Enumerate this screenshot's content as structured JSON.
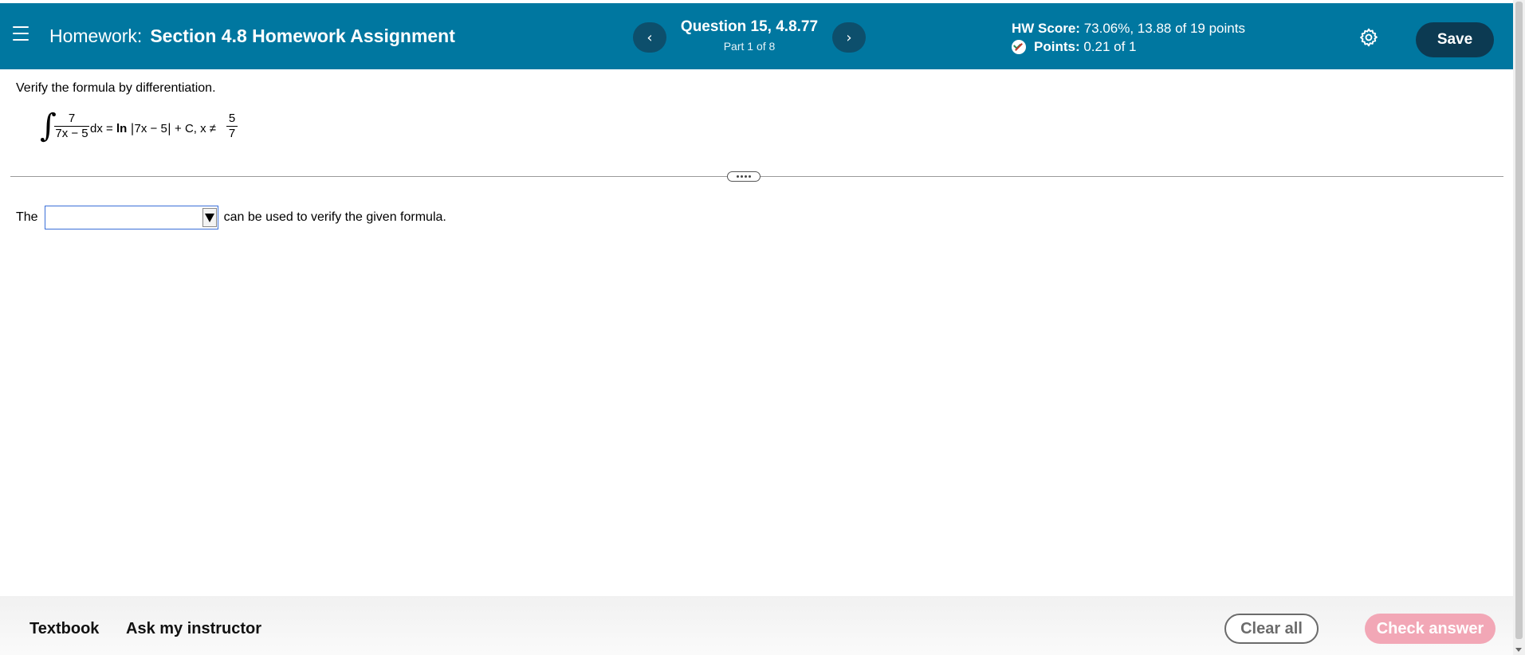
{
  "header": {
    "homework_prefix": "Homework:",
    "homework_name": "Section 4.8 Homework Assignment",
    "question_title": "Question 15, 4.8.77",
    "question_part": "Part 1 of 8",
    "prev_label": "‹",
    "next_label": "›",
    "hw_score_label": "HW Score:",
    "hw_score_value": "73.06%, 13.88 of 19 points",
    "points_label": "Points:",
    "points_value": "0.21 of 1",
    "save_label": "Save",
    "colors": {
      "background": "#0077a0",
      "nav_button": "#0d4f6c",
      "save_button": "#0c3a52"
    }
  },
  "question": {
    "prompt": "Verify the formula by differentiation.",
    "formula": {
      "integral_sign": "∫",
      "lhs_numerator": "7",
      "lhs_denominator": "7x − 5",
      "dx_eq": "dx =",
      "ln": "ln",
      "abs_open": "|",
      "abs_content": "7x − 5",
      "abs_close": "|",
      "plus_c": "+ C, x ≠",
      "rhs_numerator": "5",
      "rhs_denominator": "7"
    },
    "answer_prefix": "The",
    "answer_select_value": "",
    "answer_suffix": "can be used to verify the given formula."
  },
  "footer": {
    "textbook_label": "Textbook",
    "ask_instructor_label": "Ask my instructor",
    "clear_all_label": "Clear all",
    "check_answer_label": "Check answer",
    "colors": {
      "check_answer_bg": "#f2a7b6",
      "clear_all_border": "#6b6b6b"
    }
  },
  "icons": {
    "menu": "hamburger-menu-icon",
    "status": "partial-credit-icon",
    "settings": "gear-icon",
    "more": "ellipsis-icon"
  }
}
